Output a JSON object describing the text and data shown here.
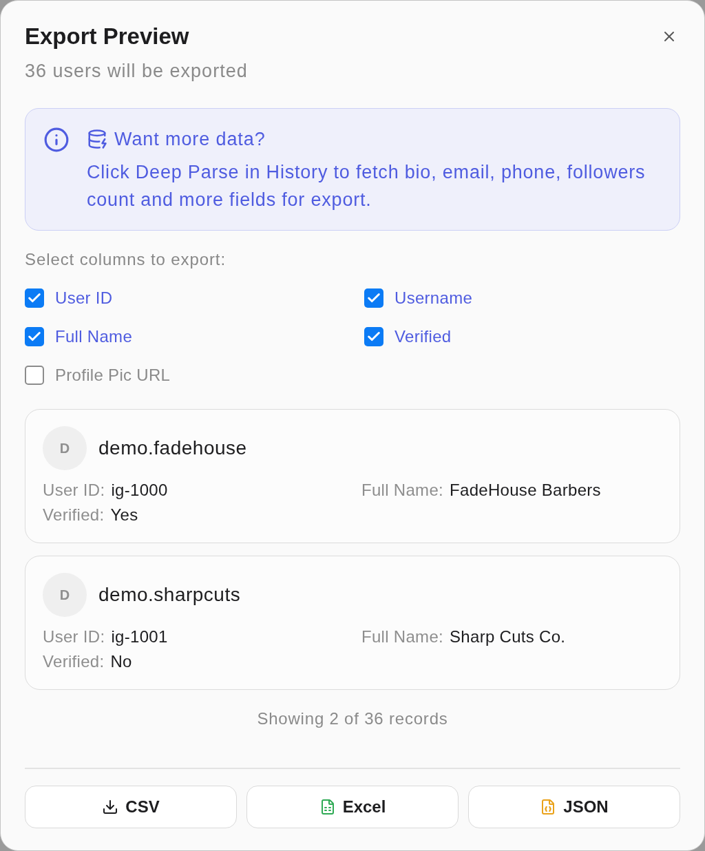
{
  "dialog": {
    "title": "Export Preview",
    "subtitle": "36 users will be exported"
  },
  "notice": {
    "heading": "Want more data?",
    "body": "Click Deep Parse in History to fetch bio, email, phone, followers count and more fields for export."
  },
  "columns": {
    "label": "Select columns to export:",
    "options": [
      {
        "label": "User ID",
        "checked": true
      },
      {
        "label": "Username",
        "checked": true
      },
      {
        "label": "Full Name",
        "checked": true
      },
      {
        "label": "Verified",
        "checked": true
      },
      {
        "label": "Profile Pic URL",
        "checked": false
      }
    ]
  },
  "records": [
    {
      "avatar": "D",
      "username": "demo.fadehouse",
      "fields": [
        {
          "label": "User ID:",
          "value": "ig-1000"
        },
        {
          "label": "Full Name:",
          "value": "FadeHouse Barbers"
        },
        {
          "label": "Verified:",
          "value": "Yes"
        }
      ]
    },
    {
      "avatar": "D",
      "username": "demo.sharpcuts",
      "fields": [
        {
          "label": "User ID:",
          "value": "ig-1001"
        },
        {
          "label": "Full Name:",
          "value": "Sharp Cuts Co."
        },
        {
          "label": "Verified:",
          "value": "No"
        }
      ]
    }
  ],
  "footer_note": "Showing 2 of 36 records",
  "export_buttons": [
    {
      "label": "CSV",
      "kind": "download"
    },
    {
      "label": "Excel",
      "kind": "sheet"
    },
    {
      "label": "JSON",
      "kind": "code"
    }
  ]
}
